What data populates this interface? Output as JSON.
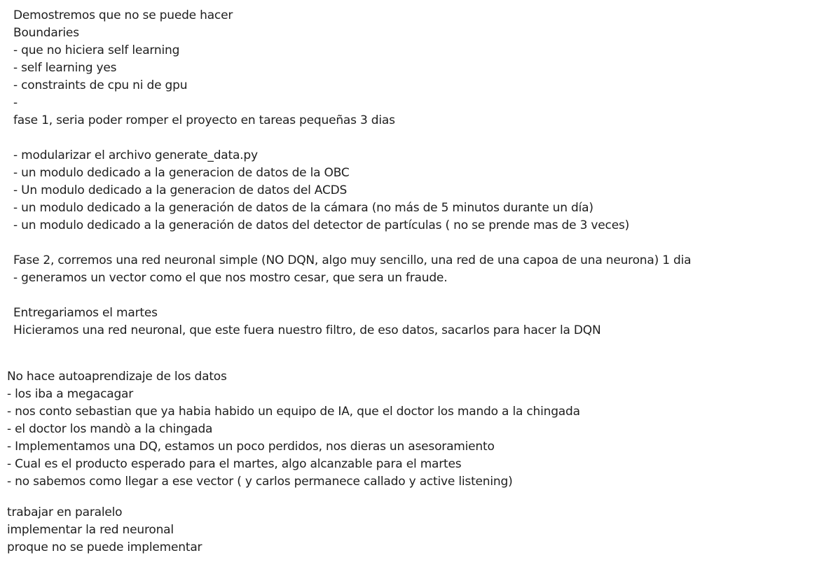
{
  "notes": {
    "block1": [
      "Demostremos que no se puede hacer",
      "Boundaries",
      "- que no hiciera self learning",
      "- self learning yes",
      "- constraints de cpu ni de gpu",
      "-",
      "fase 1, seria poder romper el proyecto en tareas pequeñas 3 dias",
      "- modularizar el archivo generate_data.py",
      "- un modulo dedicado a la generacion de datos de la OBC",
      "- Un modulo dedicado a la generacion de datos del ACDS",
      "- un modulo dedicado a la generación de datos de la cámara (no más de 5 minutos durante un día)",
      "- un modulo dedicado a la generación de datos del detector de partículas ( no se prende mas de 3 veces)",
      "Fase 2, corremos una red neuronal simple (NO DQN, algo muy sencillo, una red de una capoa de una neurona) 1 dia",
      "- generamos un vector como el que nos mostro cesar, que sera un fraude.",
      "Entregariamos el martes",
      "Hicieramos una red neuronal, que este fuera nuestro filtro, de eso datos, sacarlos para hacer la DQN"
    ],
    "block2": [
      "No hace autoaprendizaje de los datos",
      "- los iba a megacagar",
      "- nos conto sebastian que ya habia habido un equipo de IA, que el doctor los mando a la chingada",
      "- el doctor los mandò a la chingada",
      "- Implementamos una DQ, estamos un poco perdidos, nos dieras un asesoramiento",
      "- Cual es el producto esperado para el martes, algo alcanzable para el martes",
      "- no sabemos como llegar a ese vector ( y carlos permanece callado y active listening)",
      "trabajar en paralelo",
      "implementar la red neuronal",
      "proque no se puede implementar"
    ]
  }
}
